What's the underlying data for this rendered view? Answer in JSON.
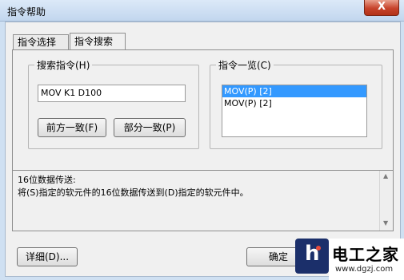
{
  "window": {
    "title": "指令帮助",
    "close_symbol": "X"
  },
  "tabs": [
    {
      "label": "指令选择",
      "active": false
    },
    {
      "label": "指令搜索",
      "active": true
    }
  ],
  "search_group": {
    "label": "搜索指令(H)",
    "input_value": "MOV K1 D100",
    "buttons": {
      "prefix_match": "前方一致(F)",
      "partial_match": "部分一致(P)"
    }
  },
  "list_group": {
    "label": "指令一览(C)",
    "items": [
      {
        "text": "MOV(P) [2]",
        "selected": true
      },
      {
        "text": "MOV(P) [2]",
        "selected": false
      }
    ]
  },
  "description": {
    "lines": [
      "16位数据传送:",
      "将(S)指定的软元件的16位数据传送到(D)指定的软元件中。"
    ]
  },
  "footer": {
    "detail_button": "详细(D)...",
    "ok_button": "确定"
  },
  "watermark": {
    "name": "电工之家",
    "url": "www.dgzj.com"
  },
  "colors": {
    "selection": "#3399ff",
    "watermark_blue": "#1b2f6a"
  }
}
